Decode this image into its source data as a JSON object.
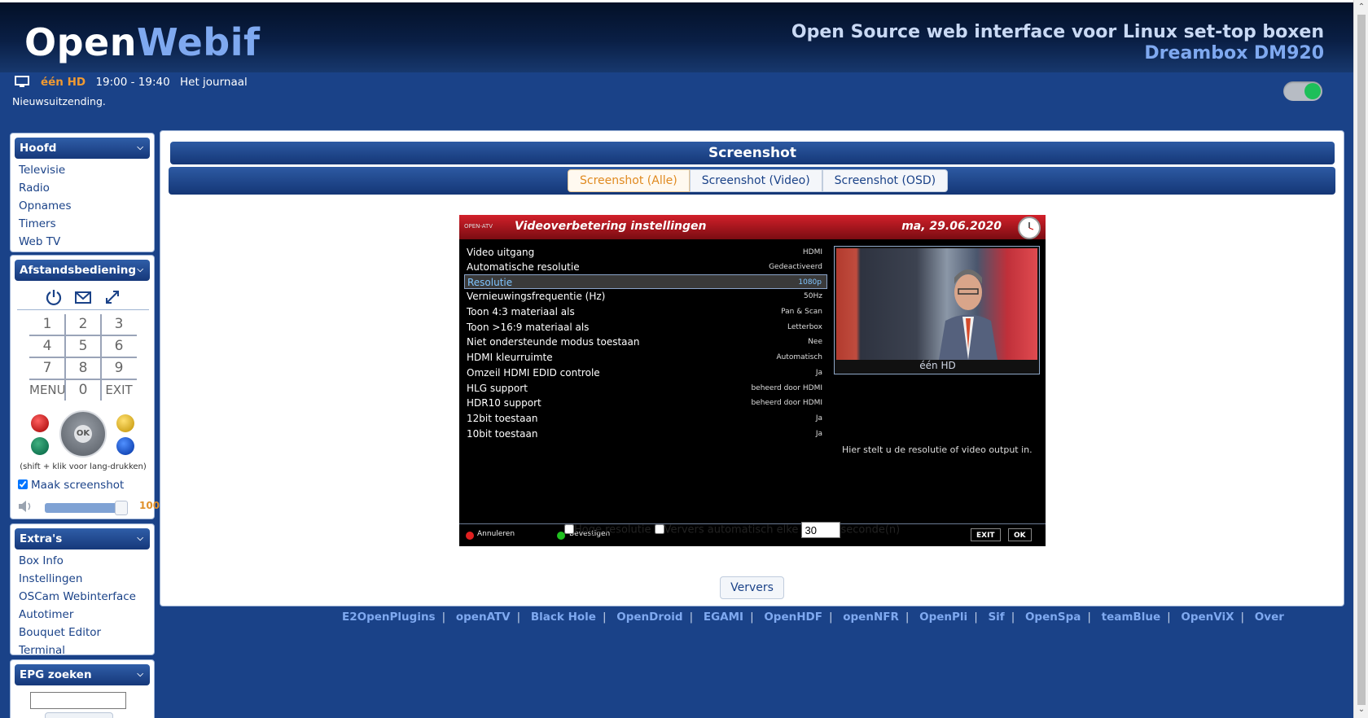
{
  "header": {
    "logo_part1": "Open",
    "logo_part2": "Webif",
    "tagline": "Open Source web interface voor Linux set-top boxen",
    "device": "Dreambox DM920"
  },
  "now_playing": {
    "channel": "één HD",
    "time": "19:00 - 19:40",
    "title": "Het journaal",
    "description": "Nieuwsuitzending."
  },
  "sidebar": {
    "main": {
      "title": "Hoofd",
      "items": [
        {
          "label": "Televisie"
        },
        {
          "label": "Radio"
        },
        {
          "label": "Opnames"
        },
        {
          "label": "Timers"
        },
        {
          "label": "Web TV"
        }
      ]
    },
    "remote": {
      "title": "Afstandsbediening",
      "keys": [
        "1",
        "2",
        "3",
        "4",
        "5",
        "6",
        "7",
        "8",
        "9",
        "MENU",
        "0",
        "EXIT"
      ],
      "ok_label": "OK",
      "longpress_hint": "(shift + klik voor lang-drukken)",
      "screenshot_label": "Maak screenshot",
      "volume": 100,
      "volume_text": "100"
    },
    "extras": {
      "title": "Extra's",
      "items": [
        {
          "label": "Box Info"
        },
        {
          "label": "Instellingen"
        },
        {
          "label": "OSCam Webinterface"
        },
        {
          "label": "Autotimer"
        },
        {
          "label": "Bouquet Editor"
        },
        {
          "label": "Terminal"
        }
      ]
    },
    "epg": {
      "title": "EPG zoeken",
      "input_value": ""
    }
  },
  "content": {
    "title": "Screenshot",
    "tabs": [
      {
        "label": "Screenshot (Alle)",
        "active": true
      },
      {
        "label": "Screenshot (Video)",
        "active": false
      },
      {
        "label": "Screenshot (OSD)",
        "active": false
      }
    ],
    "tv": {
      "logo": "OPEN-ATV",
      "menu_title": "Videoverbetering instellingen",
      "date": "ma, 29.06.2020",
      "rows": [
        {
          "label": "Video uitgang",
          "value": "HDMI"
        },
        {
          "label": "Automatische resolutie",
          "value": "Gedeactiveerd"
        },
        {
          "label": "Resolutie",
          "value": "1080p",
          "selected": true
        },
        {
          "label": "Vernieuwingsfrequentie (Hz)",
          "value": "50Hz"
        },
        {
          "label": "Toon 4:3 materiaal als",
          "value": "Pan & Scan"
        },
        {
          "label": "Toon >16:9 materiaal als",
          "value": "Letterbox"
        },
        {
          "label": "Niet ondersteunde modus toestaan",
          "value": "Nee"
        },
        {
          "label": "HDMI kleurruimte",
          "value": "Automatisch"
        },
        {
          "label": "Omzeil HDMI EDID controle",
          "value": "Ja"
        },
        {
          "label": "HLG support",
          "value": "beheerd door HDMI"
        },
        {
          "label": "HDR10 support",
          "value": "beheerd door HDMI"
        },
        {
          "label": "12bit toestaan",
          "value": "Ja"
        },
        {
          "label": "10bit toestaan",
          "value": "Ja"
        }
      ],
      "preview_channel": "één HD",
      "help_text": "Hier stelt u de resolutie of video output in.",
      "footer_cancel": "Annuleren",
      "footer_confirm": "Bevestigen",
      "footer_exit": "EXIT",
      "footer_ok": "OK"
    },
    "options": {
      "high_res_label": "Hoge resolutie",
      "auto_refresh_label": "Ververs automatisch elke",
      "interval": "30",
      "seconds_label": "seconde(n)",
      "refresh_button": "Ververs"
    }
  },
  "footer_links": [
    "E2OpenPlugins",
    "openATV",
    "Black Hole",
    "OpenDroid",
    "EGAMI",
    "OpenHDF",
    "openNFR",
    "OpenPli",
    "Sif",
    "OpenSpa",
    "teamBlue",
    "OpenViX",
    "Over"
  ],
  "colors": {
    "brand_blue": "#1a4288",
    "accent_orange": "#e08a20",
    "logo_light_blue": "#7fa9f0"
  }
}
